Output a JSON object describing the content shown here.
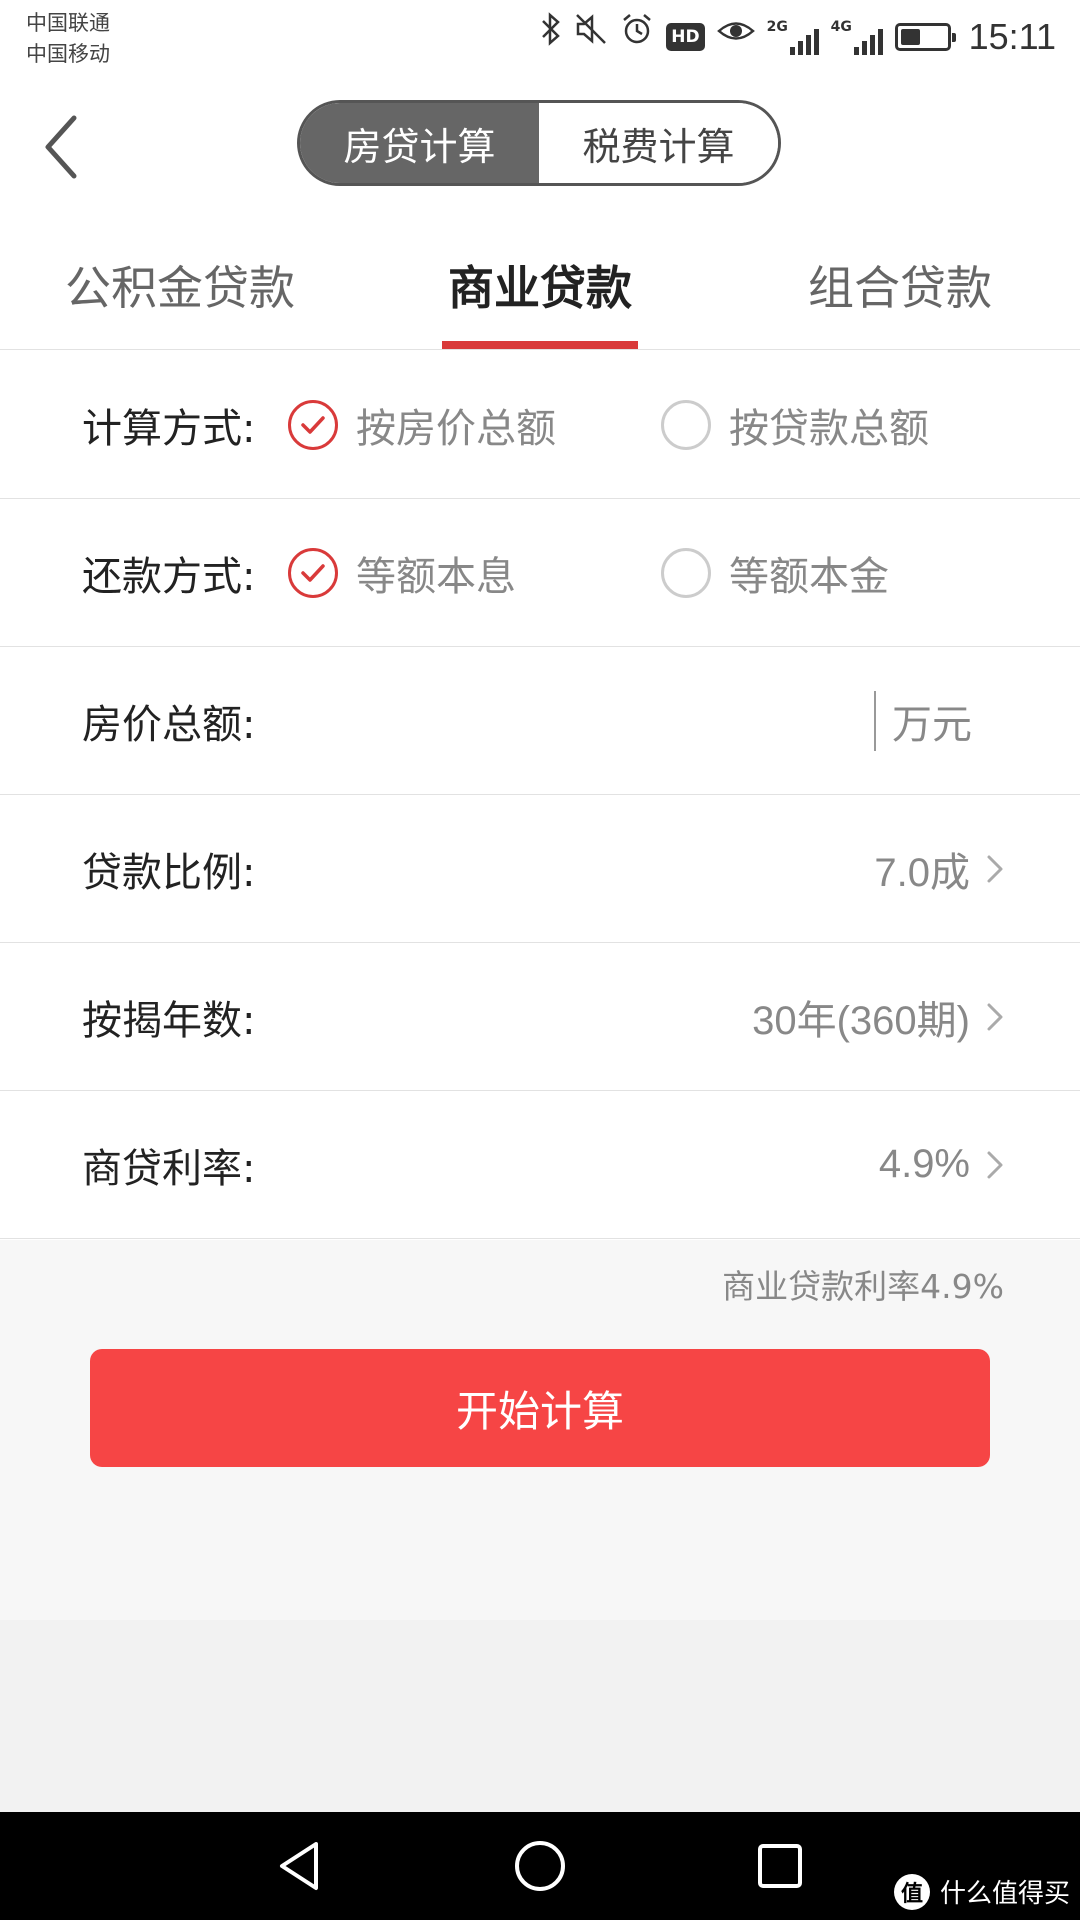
{
  "status_bar": {
    "carrier_1": "中国联通",
    "carrier_2": "中国移动",
    "network_1": "2G",
    "network_2": "4G",
    "hd_badge": "HD",
    "time": "15:11"
  },
  "header": {
    "segments": [
      {
        "label": "房贷计算",
        "active": true
      },
      {
        "label": "税费计算",
        "active": false
      }
    ]
  },
  "loan_tabs": [
    {
      "label": "公积金贷款",
      "active": false
    },
    {
      "label": "商业贷款",
      "active": true
    },
    {
      "label": "组合贷款",
      "active": false
    }
  ],
  "form": {
    "calc_method": {
      "label": "计算方式:",
      "options": [
        {
          "label": "按房价总额",
          "checked": true
        },
        {
          "label": "按贷款总额",
          "checked": false
        }
      ]
    },
    "repay_method": {
      "label": "还款方式:",
      "options": [
        {
          "label": "等额本息",
          "checked": true
        },
        {
          "label": "等额本金",
          "checked": false
        }
      ]
    },
    "house_price": {
      "label": "房价总额:",
      "value": "",
      "placeholder": "",
      "unit": "万元"
    },
    "loan_ratio": {
      "label": "贷款比例:",
      "value": "7.0成"
    },
    "mortgage_years": {
      "label": "按揭年数:",
      "value": "30年(360期)"
    },
    "commercial_rate": {
      "label": "商贷利率:",
      "value": "4.9%"
    }
  },
  "rate_note": "商业贷款利率4.9%",
  "calc_button": "开始计算",
  "watermark": {
    "logo": "值",
    "text": "什么值得买"
  },
  "colors": {
    "accent_red": "#d93a3a",
    "button_red": "#f64545",
    "segment_active": "#666666"
  }
}
